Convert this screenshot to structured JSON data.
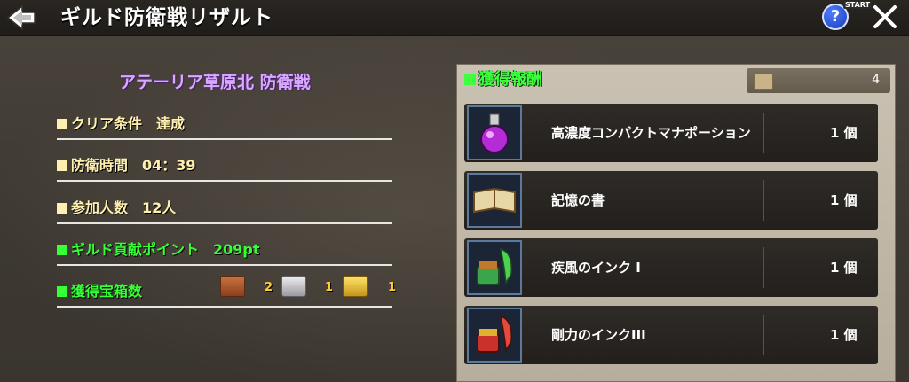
{
  "header": {
    "title": "ギルド防衛戦リザルト",
    "help_label": "?",
    "start_label": "START"
  },
  "left": {
    "stage_title": "アテーリア草原北 防衛戦",
    "rows": [
      {
        "text": "クリア条件　達成"
      },
      {
        "text": "防衛時間　04：39"
      },
      {
        "text": "参加人数　12人"
      },
      {
        "text": "ギルド貢献ポイント　209pt"
      },
      {
        "text": "獲得宝箱数"
      }
    ],
    "chests": [
      {
        "type": "bronze",
        "count": "2",
        "color": "#b0582d"
      },
      {
        "type": "silver",
        "count": "1",
        "color": "#c8c8cc"
      },
      {
        "type": "gold",
        "count": "1",
        "color": "#f2c230"
      }
    ]
  },
  "rewards": {
    "header": "獲得報酬",
    "total_count": "4",
    "items": [
      {
        "name": "高濃度コンパクトマナポーション",
        "qty": "1 個",
        "icon": "potion-icon"
      },
      {
        "name": "記憶の書",
        "qty": "1 個",
        "icon": "book-icon"
      },
      {
        "name": "疾風のインク I",
        "qty": "1 個",
        "icon": "green-ink-icon"
      },
      {
        "name": "剛力のインクIII",
        "qty": "1 個",
        "icon": "red-ink-icon"
      }
    ]
  },
  "colors": {
    "header_bg": "#1f1c19",
    "stage_title": "#d8a8ff",
    "stat_text": "#fff0b0",
    "green_text": "#36ff36",
    "reward_header": "#3dff3d"
  }
}
